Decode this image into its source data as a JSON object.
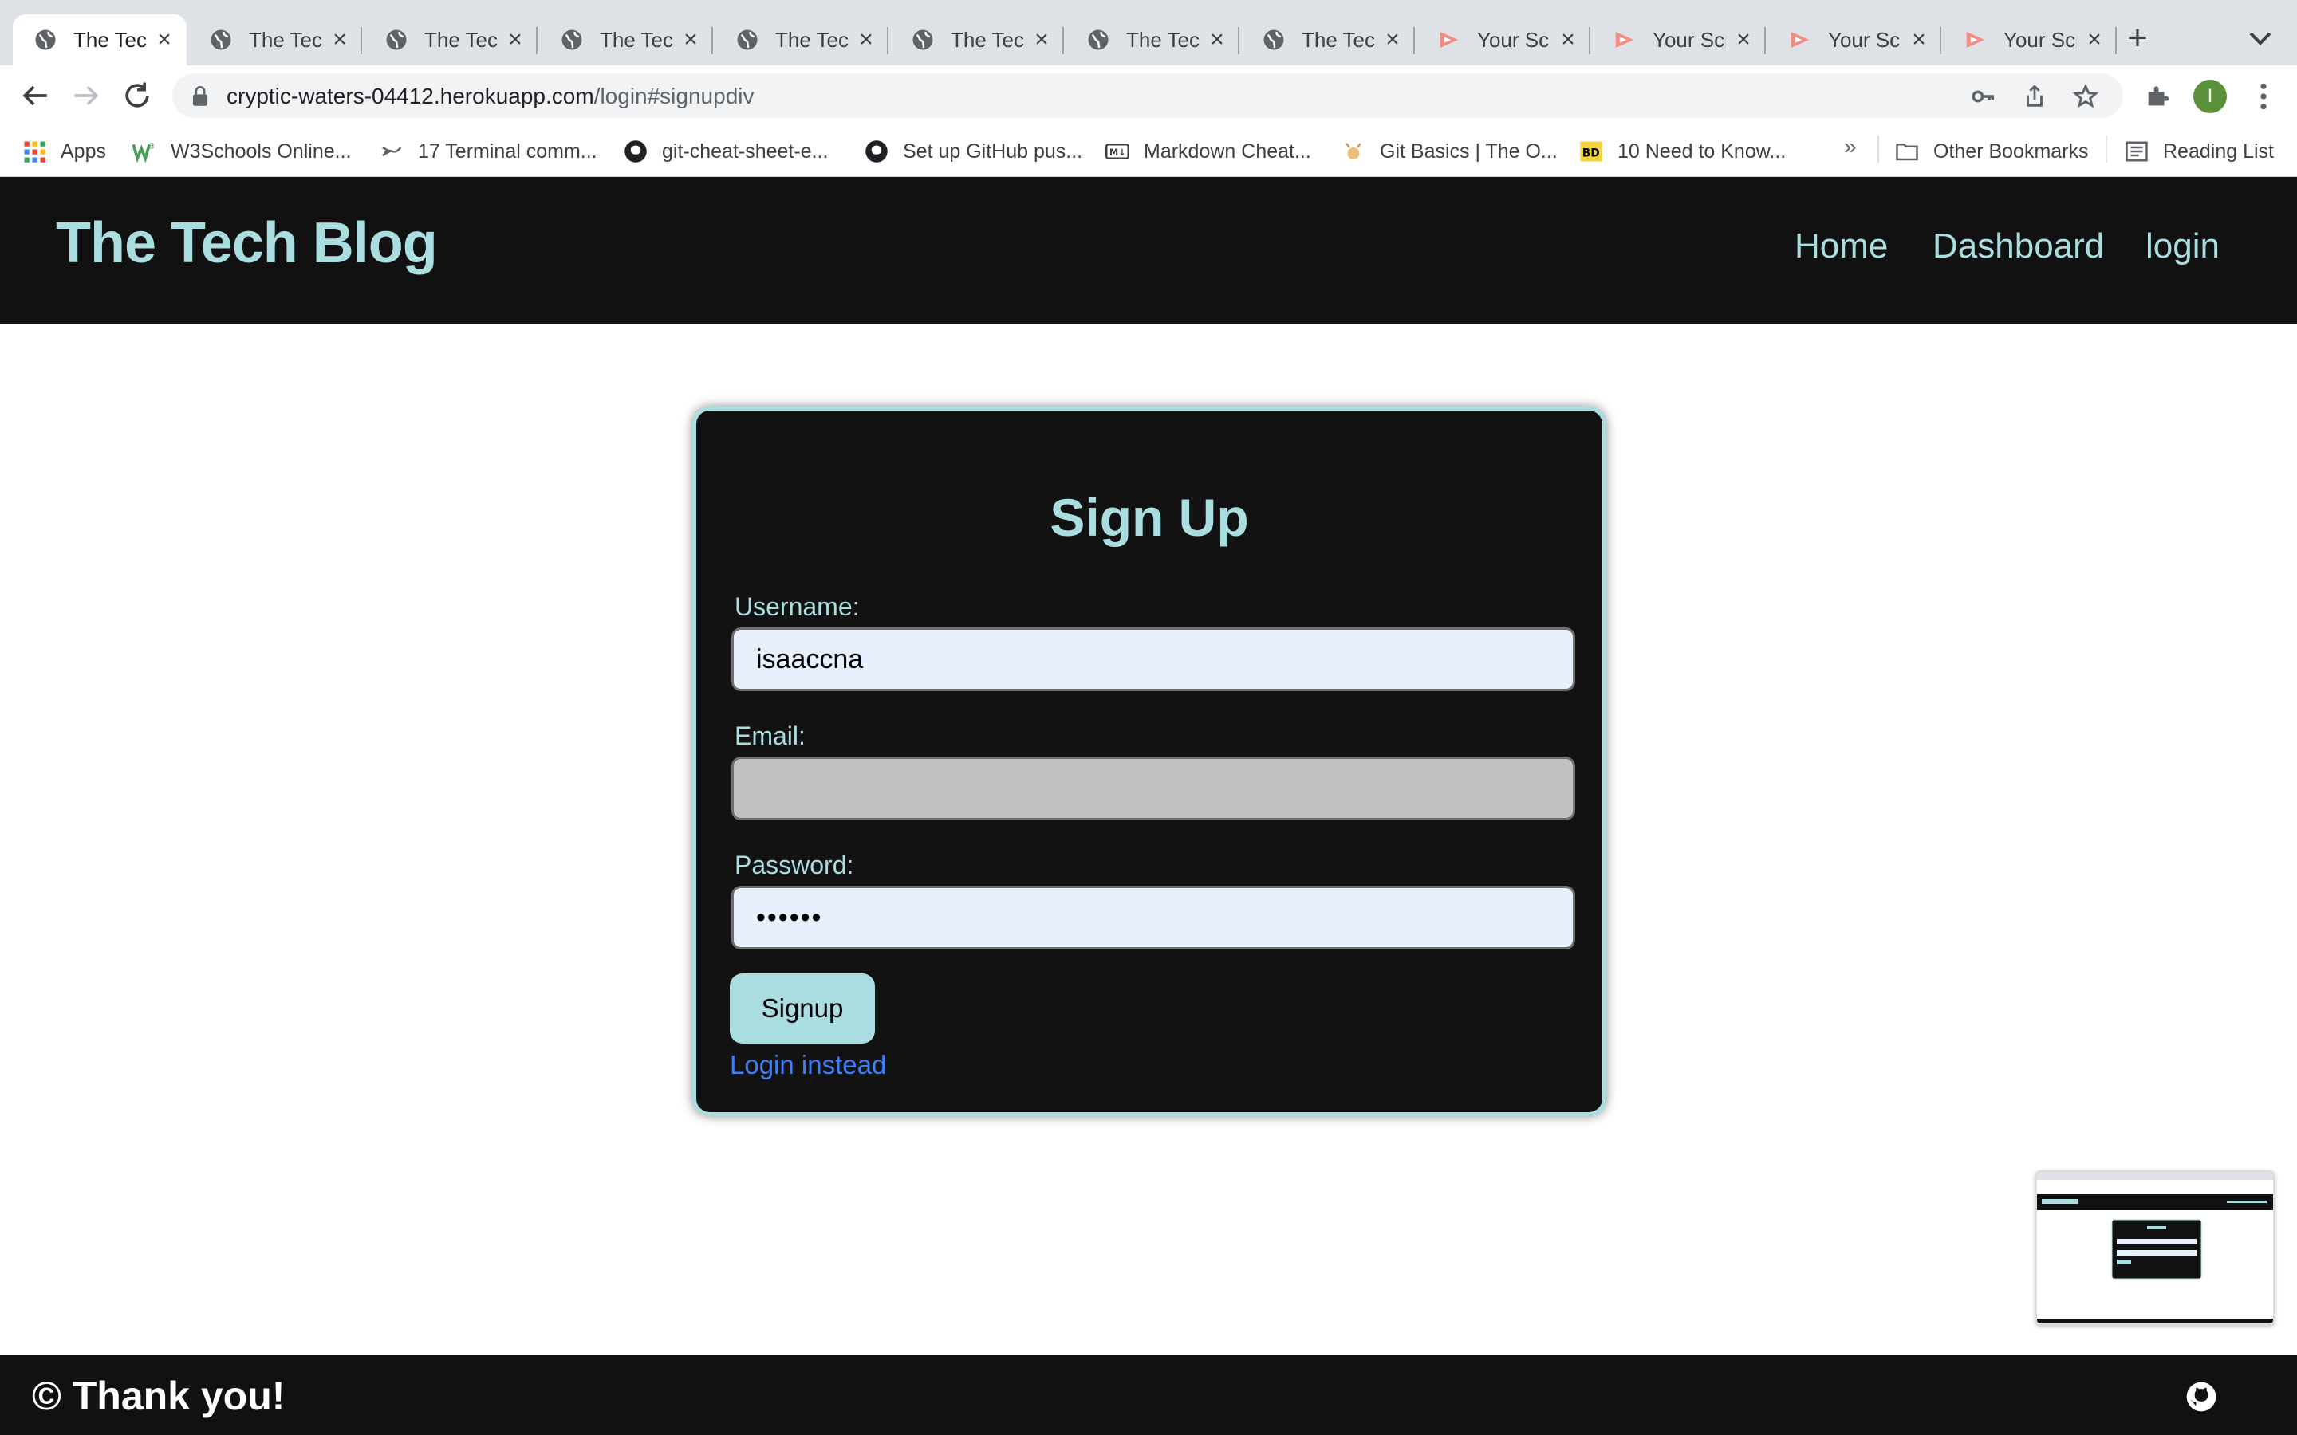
{
  "browser": {
    "tabs": [
      {
        "title": "The Tech Blog",
        "icon": "globe-icon",
        "active": true
      },
      {
        "title": "The Tech Blog",
        "icon": "globe-icon"
      },
      {
        "title": "The Tech Blog",
        "icon": "globe-icon"
      },
      {
        "title": "The Tech Blog",
        "icon": "globe-icon"
      },
      {
        "title": "The Tech Blog",
        "icon": "globe-icon"
      },
      {
        "title": "The Tech Blog",
        "icon": "globe-icon"
      },
      {
        "title": "The Tech Blog",
        "icon": "globe-icon"
      },
      {
        "title": "The Tech Blog",
        "icon": "globe-icon"
      },
      {
        "title": "Your Screencastify",
        "icon": "screencastify-icon"
      },
      {
        "title": "Your Screencastify",
        "icon": "screencastify-icon"
      },
      {
        "title": "Your Screencastify",
        "icon": "screencastify-icon"
      },
      {
        "title": "Your Screencastify",
        "icon": "screencastify-icon"
      }
    ],
    "url_host": "cryptic-waters-04412.herokuapp.com",
    "url_path": "/login#signupdiv",
    "profile_initial": "I",
    "bookmarks": [
      {
        "label": "Apps",
        "icon": "apps-grid-icon"
      },
      {
        "label": "W3Schools Online...",
        "icon": "w3schools-icon"
      },
      {
        "label": "17 Terminal comm...",
        "icon": "terminal-icon"
      },
      {
        "label": "git-cheat-sheet-e...",
        "icon": "github-icon"
      },
      {
        "label": "Set up GitHub pus...",
        "icon": "github-icon"
      },
      {
        "label": "Markdown Cheat...",
        "icon": "markdown-icon"
      },
      {
        "label": "Git Basics | The O...",
        "icon": "odin-icon"
      },
      {
        "label": "10 Need to Know...",
        "icon": "bd-icon"
      }
    ],
    "bookmarks_overflow": "»",
    "other_bookmarks": "Other Bookmarks",
    "reading_list": "Reading List"
  },
  "site": {
    "title": "The Tech Blog",
    "nav": [
      "Home",
      "Dashboard",
      "login"
    ],
    "footer": "© Thank you!"
  },
  "signup": {
    "heading": "Sign Up",
    "username_label": "Username:",
    "username_value": "isaaccna",
    "email_label": "Email:",
    "email_value": "",
    "password_label": "Password:",
    "password_value": "••••••",
    "submit_label": "Signup",
    "login_link": "Login instead"
  },
  "colors": {
    "accent": "#a9dde0",
    "header_bg": "#111111",
    "link": "#3d7eff",
    "autofill": "#e8f0fe"
  }
}
